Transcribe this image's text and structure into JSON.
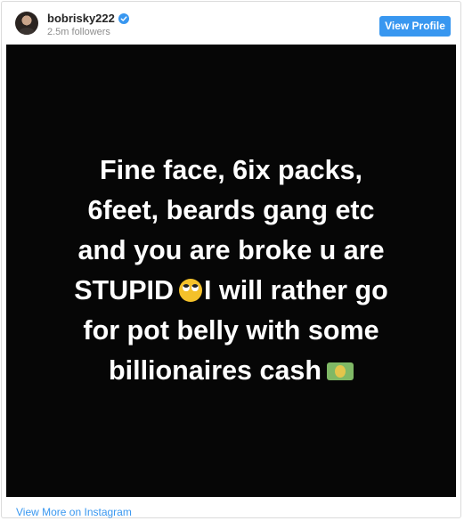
{
  "header": {
    "username": "bobrisky222",
    "followers": "2.5m followers",
    "view_profile_label": "View Profile",
    "verified_icon": "verified-badge-icon"
  },
  "post": {
    "image_text_lines": [
      "Fine face, 6ix packs,",
      "6feet, beards gang etc",
      "and you are broke u are",
      "STUPID",
      "I will rather go",
      "for pot belly with some",
      "billionaires cash"
    ],
    "emojis": [
      "face-with-rolling-eyes-icon",
      "dollar-banknote-icon"
    ]
  },
  "footer": {
    "link_label": "View More on Instagram"
  },
  "colors": {
    "accent": "#3897f0",
    "media_bg": "#060606",
    "text_muted": "#8e8e8e",
    "username": "#262626"
  }
}
